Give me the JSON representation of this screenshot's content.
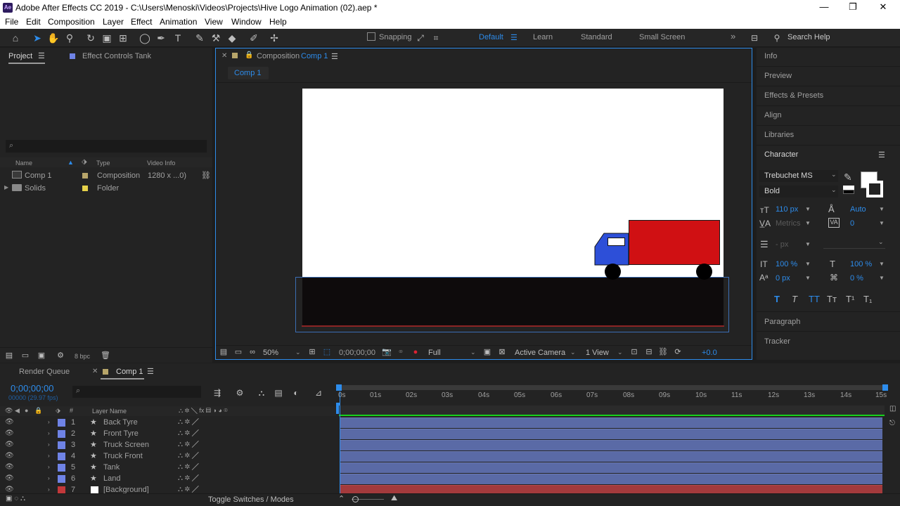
{
  "titlebar": {
    "logo": "Ae",
    "title": "Adobe After Effects CC 2019 - C:\\Users\\Menoski\\Videos\\Projects\\Hive Logo Animation (02).aep *",
    "minimize": "—",
    "restore": "❐",
    "close": "✕"
  },
  "menu": [
    "File",
    "Edit",
    "Composition",
    "Layer",
    "Effect",
    "Animation",
    "View",
    "Window",
    "Help"
  ],
  "toolbar": {
    "snapping_label": "Snapping",
    "workspaces": [
      "Default",
      "Learn",
      "Standard",
      "Small Screen"
    ],
    "more": "»",
    "search_placeholder": "Search Help"
  },
  "project_panel": {
    "tab_project": "Project",
    "tab_effect_controls": "Effect Controls Tank",
    "search_icon": "⌕",
    "columns": {
      "name": "Name",
      "type": "Type",
      "video_info": "Video Info"
    },
    "items": [
      {
        "name": "Comp 1",
        "type": "Composition",
        "info": "1280 x ...0)",
        "color": "#b7a56a"
      },
      {
        "name": "Solids",
        "type": "Folder",
        "info": "",
        "color": "#e6d24a"
      }
    ],
    "bpc": "8 bpc"
  },
  "composition_panel": {
    "tab_prefix": "Composition",
    "tab_name": "Comp 1",
    "breadcrumb": "Comp 1",
    "zoom": "50%",
    "timecode": "0;00;00;00",
    "resolution": "Full",
    "camera": "Active Camera",
    "views": "1 View",
    "exposure": "+0.0",
    "colors": {
      "sky": "#ffffff",
      "ground": "#0e0b0c",
      "truck_body": "#d01013",
      "truck_cab": "#2d4fd8",
      "wheel": "#000000"
    }
  },
  "right_panels": {
    "collapsed": [
      "Info",
      "Preview",
      "Effects & Presets",
      "Align",
      "Libraries"
    ],
    "character": {
      "title": "Character",
      "font": "Trebuchet MS",
      "style": "Bold",
      "size": "110 px",
      "leading": "Auto",
      "kerning": "Metrics",
      "tracking": "0",
      "stroke_width": "- px",
      "vertical_scale": "100 %",
      "horizontal_scale": "100 %",
      "baseline_shift": "0 px",
      "tsume": "0 %",
      "style_buttons": [
        "T",
        "T",
        "TT",
        "Tт",
        "T¹",
        "T₁"
      ]
    },
    "paragraph": "Paragraph",
    "tracker": "Tracker"
  },
  "timeline": {
    "tab_render_queue": "Render Queue",
    "tab_comp": "Comp 1",
    "timecode": "0;00;00;00",
    "fps": "00000 (29.97 fps)",
    "col_number": "#",
    "col_layer_name": "Layer Name",
    "layers": [
      {
        "num": "1",
        "name": "Back Tyre",
        "color": "#6f83e6"
      },
      {
        "num": "2",
        "name": "Front Tyre",
        "color": "#6f83e6"
      },
      {
        "num": "3",
        "name": "Truck Screen",
        "color": "#6f83e6"
      },
      {
        "num": "4",
        "name": "Truck Front",
        "color": "#6f83e6"
      },
      {
        "num": "5",
        "name": "Tank",
        "color": "#6f83e6"
      },
      {
        "num": "6",
        "name": "Land",
        "color": "#6f83e6"
      },
      {
        "num": "7",
        "name": "[Background]",
        "color": "#c2383a"
      }
    ],
    "ruler": [
      "0s",
      "01s",
      "02s",
      "03s",
      "04s",
      "05s",
      "06s",
      "07s",
      "08s",
      "09s",
      "10s",
      "11s",
      "12s",
      "13s",
      "14s",
      "15s"
    ],
    "toggle_label": "Toggle Switches / Modes"
  }
}
